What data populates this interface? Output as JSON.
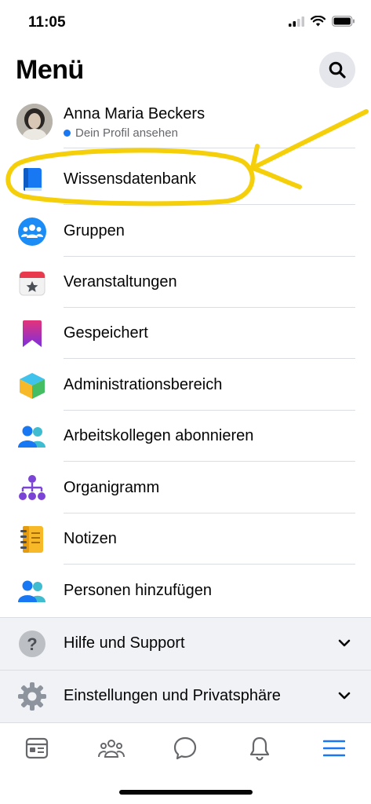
{
  "status": {
    "time": "11:05"
  },
  "header": {
    "title": "Menü"
  },
  "profile": {
    "name": "Anna Maria Beckers",
    "subtitle": "Dein Profil ansehen"
  },
  "menu": [
    {
      "label": "Wissensdatenbank",
      "icon": "book-icon"
    },
    {
      "label": "Gruppen",
      "icon": "groups-icon"
    },
    {
      "label": "Veranstaltungen",
      "icon": "calendar-icon"
    },
    {
      "label": "Gespeichert",
      "icon": "bookmark-icon"
    },
    {
      "label": "Administrationsbereich",
      "icon": "cube-icon"
    },
    {
      "label": "Arbeitskollegen abonnieren",
      "icon": "people-icon"
    },
    {
      "label": "Organigramm",
      "icon": "org-chart-icon"
    },
    {
      "label": "Notizen",
      "icon": "notes-icon"
    },
    {
      "label": "Personen hinzufügen",
      "icon": "add-people-icon"
    }
  ],
  "sections": [
    {
      "label": "Hilfe und Support",
      "icon": "help-icon"
    },
    {
      "label": "Einstellungen und Privatsphäre",
      "icon": "settings-icon"
    }
  ],
  "tabs": [
    "news-feed-icon",
    "groups-tab-icon",
    "chat-icon",
    "notifications-icon",
    "menu-icon"
  ],
  "colors": {
    "accent": "#1877f2",
    "annotation": "#f5cf0a"
  }
}
